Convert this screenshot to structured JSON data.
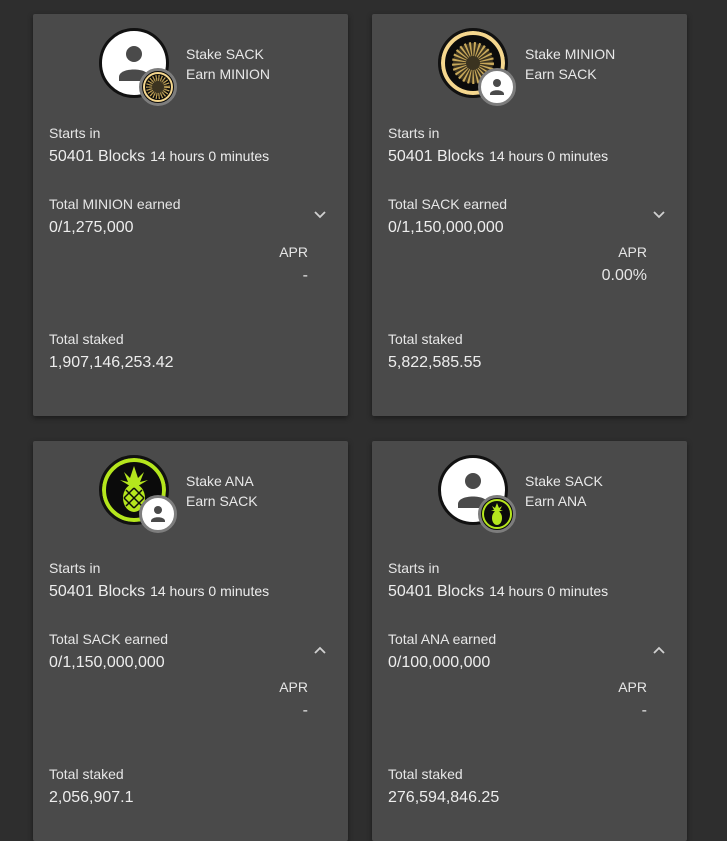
{
  "cards": [
    {
      "stake_label": "Stake SACK",
      "earn_label": "Earn MINION",
      "starts_label": "Starts in",
      "blocks": "50401 Blocks",
      "duration": "14 hours 0 minutes",
      "earned_label": "Total MINION earned",
      "earned_value": "0/1,275,000",
      "apr_label": "APR",
      "apr_value": "-",
      "staked_label": "Total staked",
      "staked_value": "1,907,146,253.42",
      "expanded": false,
      "main_icon": "person-icon",
      "badge_icon": "minion-token-icon"
    },
    {
      "stake_label": "Stake MINION",
      "earn_label": "Earn SACK",
      "starts_label": "Starts in",
      "blocks": "50401 Blocks",
      "duration": "14 hours 0 minutes",
      "earned_label": "Total SACK earned",
      "earned_value": "0/1,150,000,000",
      "apr_label": "APR",
      "apr_value": "0.00%",
      "staked_label": "Total staked",
      "staked_value": "5,822,585.55",
      "expanded": false,
      "main_icon": "minion-token-icon",
      "badge_icon": "person-icon"
    },
    {
      "stake_label": "Stake ANA",
      "earn_label": "Earn SACK",
      "starts_label": "Starts in",
      "blocks": "50401 Blocks",
      "duration": "14 hours 0 minutes",
      "earned_label": "Total SACK earned",
      "earned_value": "0/1,150,000,000",
      "apr_label": "APR",
      "apr_value": "-",
      "staked_label": "Total staked",
      "staked_value": "2,056,907.1",
      "expanded": true,
      "main_icon": "pineapple-icon",
      "badge_icon": "person-icon"
    },
    {
      "stake_label": "Stake SACK",
      "earn_label": "Earn ANA",
      "starts_label": "Starts in",
      "blocks": "50401 Blocks",
      "duration": "14 hours 0 minutes",
      "earned_label": "Total ANA earned",
      "earned_value": "0/100,000,000",
      "apr_label": "APR",
      "apr_value": "-",
      "staked_label": "Total staked",
      "staked_value": "276,594,846.25",
      "expanded": true,
      "main_icon": "person-icon",
      "badge_icon": "pineapple-icon"
    }
  ],
  "colors": {
    "background": "#2e2e2e",
    "card": "#4a4a4a",
    "minion_ring": "#f5d78e",
    "ana_green": "#b5e61d"
  }
}
